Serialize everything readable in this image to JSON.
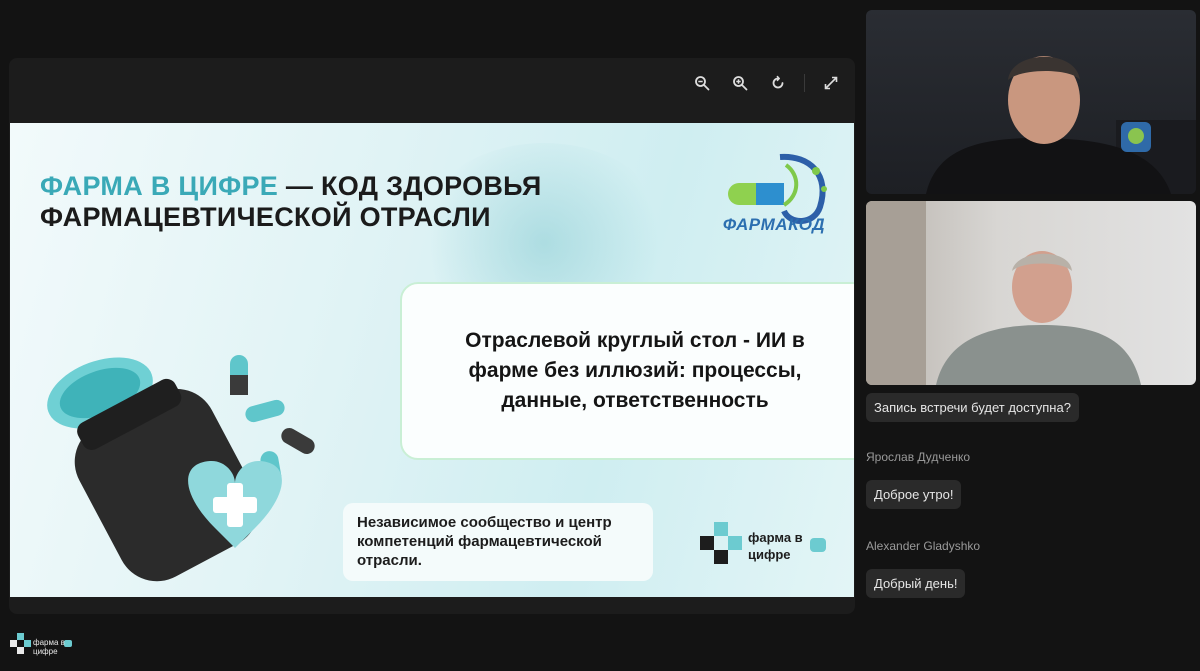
{
  "toolbar": {
    "zoom_out": "zoom-out-icon",
    "zoom_in": "zoom-in-icon",
    "rotate": "rotate-icon",
    "fullscreen": "expand-icon"
  },
  "slide": {
    "title_accent": "Фарма в цифре",
    "title_rest": " — Код здоровья фармацевтической отрасли",
    "logo_text": "ФАРМАКОД",
    "roundtable_text": "Отраслевой круглый стол - ИИ в фарме без иллюзий: процессы, данные, ответственность",
    "community_text": "Независимое сообщество и центр компетенций фармацевтической отрасли.",
    "brand_line1": "фарма в",
    "brand_line2": "цифре"
  },
  "chat": {
    "messages": [
      {
        "author": "",
        "text": "Запись встречи будет доступна?"
      },
      {
        "author": "Ярослав Дудченко",
        "text": "Доброе утро!"
      },
      {
        "author": "Alexander Gladyshko",
        "text": "Добрый день!"
      }
    ]
  },
  "bottom_logo": {
    "line1": "фарма в",
    "line2": "цифре"
  },
  "colors": {
    "accent": "#3aa9b7",
    "panel": "#1c1c1c",
    "background": "#131313",
    "bubble": "#2a2a2a"
  }
}
